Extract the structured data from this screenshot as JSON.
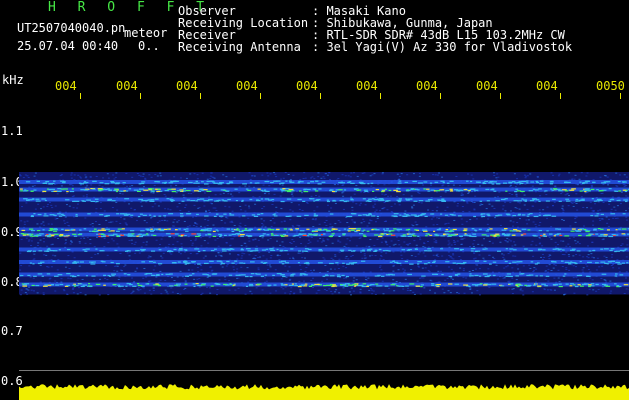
{
  "header": {
    "brand": "H R O F F T",
    "file_name": "UT2507040040.pn",
    "detection": "meteor",
    "datetime": "25.07.04 00:40",
    "count": "0.."
  },
  "info": {
    "observer_label": "Observer",
    "observer_value": ": Masaki Kano",
    "location_label": "Receiving Location",
    "location_value": ": Shibukawa, Gunma, Japan",
    "receiver_label": "Receiver",
    "receiver_value": ": RTL-SDR SDR# 43dB L15 103.2MHz CW",
    "antenna_label": "Receiving Antenna",
    "antenna_value": ": 3el Yagi(V) Az 330 for Vladivostok"
  },
  "axes": {
    "y_unit": "kHz",
    "y_ticks": [
      "1.1",
      "1.0",
      "0.9",
      "0.8",
      "0.7",
      "0.6"
    ],
    "x_ticks": [
      "004",
      "004",
      "004",
      "004",
      "004",
      "004",
      "004",
      "004",
      "004",
      "0050"
    ]
  },
  "colors": {
    "background": "#000000",
    "title": "#46e846",
    "text": "#ffffff",
    "axis": "#e8e800",
    "waterfall_base": "#10186a"
  },
  "chart_data": {
    "type": "heatmap",
    "ylabel": "kHz",
    "ylim": [
      0.6,
      1.15
    ],
    "bands": [
      {
        "freq": 1.0,
        "intensity": 0.6
      },
      {
        "freq": 0.985,
        "intensity": 0.85
      },
      {
        "freq": 0.965,
        "intensity": 0.6
      },
      {
        "freq": 0.935,
        "intensity": 0.5
      },
      {
        "freq": 0.905,
        "intensity": 0.8
      },
      {
        "freq": 0.895,
        "intensity": 1.0
      },
      {
        "freq": 0.865,
        "intensity": 0.55
      },
      {
        "freq": 0.84,
        "intensity": 0.5
      },
      {
        "freq": 0.815,
        "intensity": 0.45
      },
      {
        "freq": 0.795,
        "intensity": 0.85
      }
    ],
    "floor_level": 0.6
  }
}
